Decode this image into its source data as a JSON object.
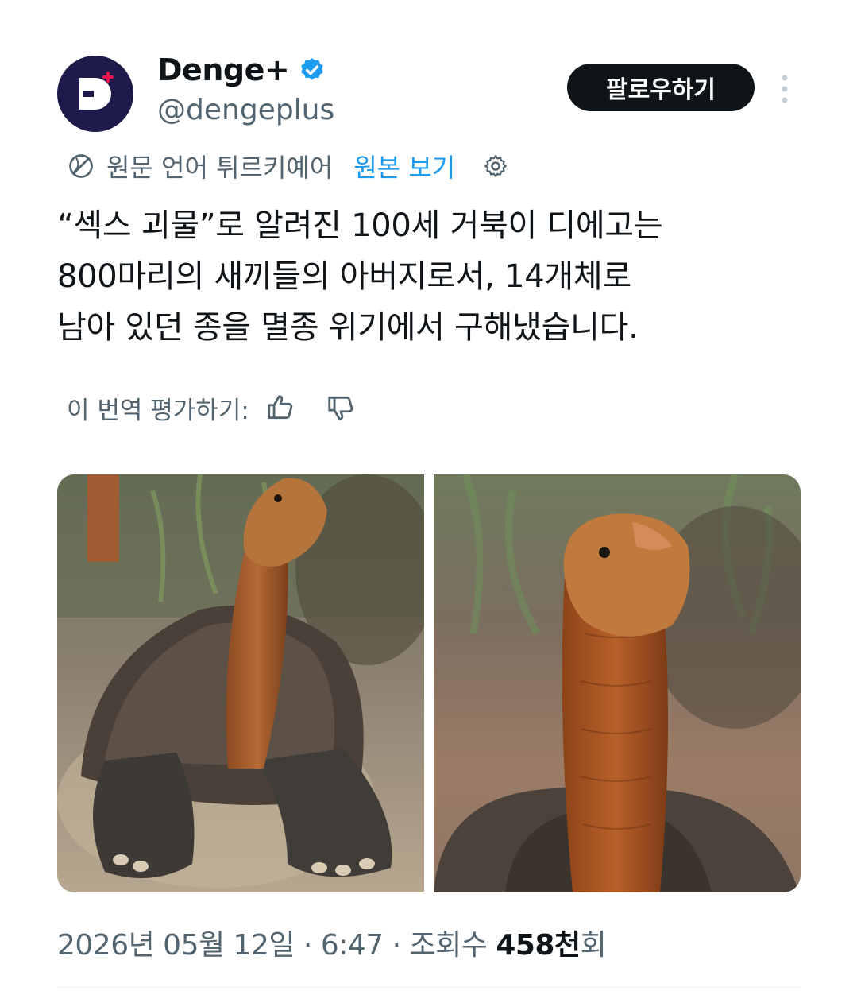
{
  "author": {
    "display_name": "Denge+",
    "handle": "@dengeplus",
    "avatar_letter": "D",
    "verified_color": "#1d9bf0",
    "avatar_bg": "#1e1a4a"
  },
  "follow_label": "팔로우하기",
  "translation": {
    "source_text": "원문 언어 튀르키예어",
    "show_original": "원본 보기"
  },
  "tweet_text": "“섹스 괴물”로 알려진 100세 거북이 디에고는\n800마리의 새끼들의 아버지로서, 14개체로\n남아 있던 종을 멸종 위기에서 구해냈습니다.",
  "rate_label": "이 번역 평가하기:",
  "meta": {
    "date": "2026년 05월 12일",
    "sep1": " · ",
    "time": "6:47",
    "sep2": " · ",
    "views_label": "조회수 ",
    "views_value": "458천",
    "views_suffix": "회"
  },
  "colors": {
    "accent": "#1d9bf0",
    "text_secondary": "#536471",
    "button_bg": "#0f1419"
  }
}
